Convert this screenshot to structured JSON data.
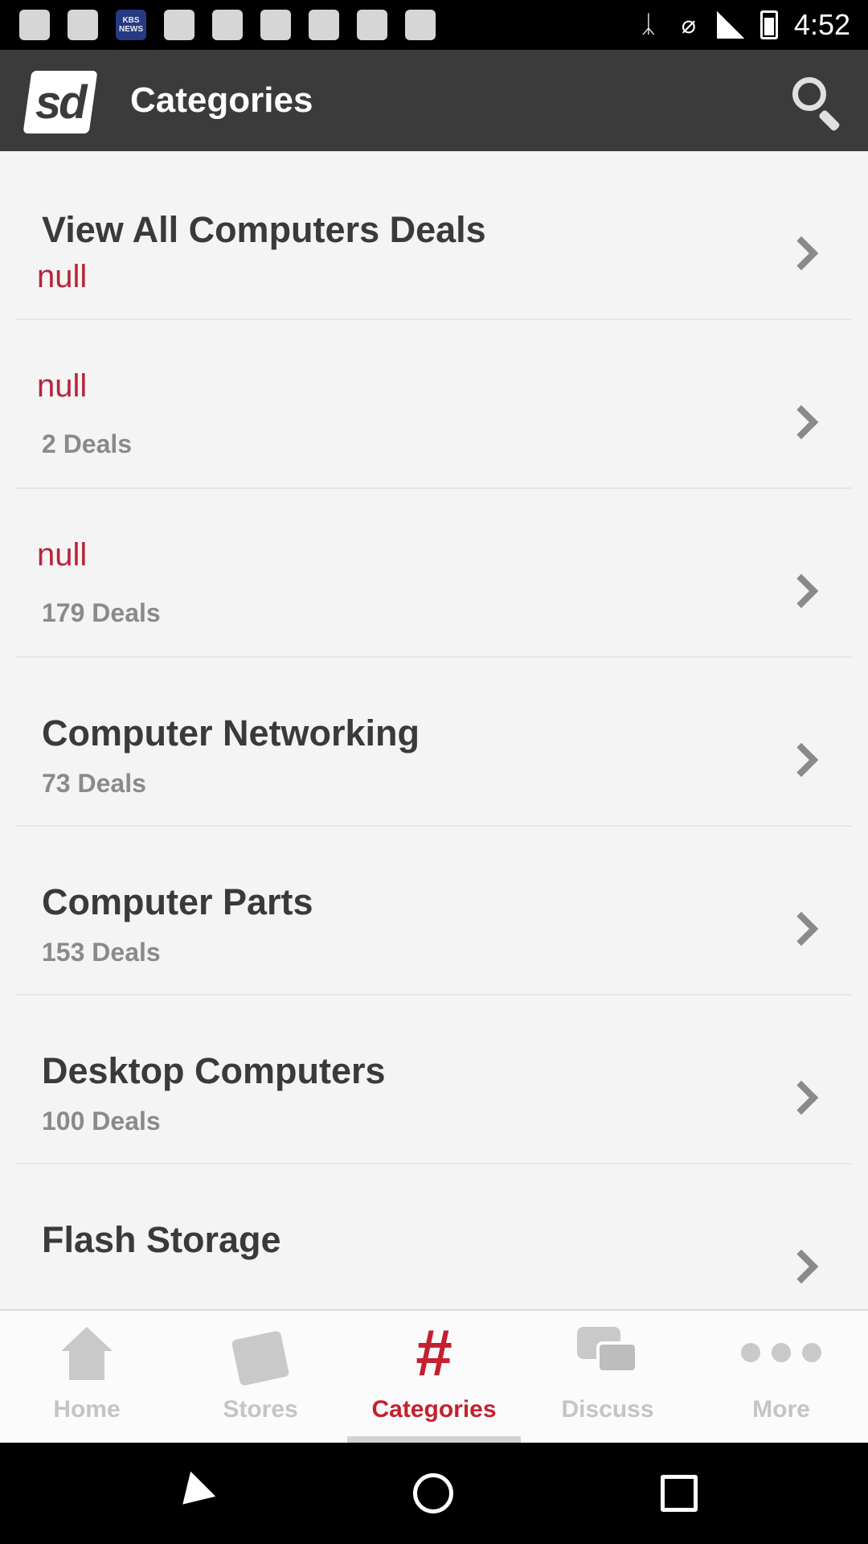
{
  "status_bar": {
    "time": "4:52",
    "left_icons": [
      "notification-icon",
      "flipboard-icon",
      "kbs-news-icon",
      "message-icon",
      "flipboard-icon",
      "proxy-icon",
      "satellite-icon",
      "lock-icon",
      "game-icon"
    ],
    "kbs_label": "KBS NEWS",
    "right_icons": [
      "bluetooth-icon",
      "mute-icon",
      "signal-icon",
      "battery-icon"
    ]
  },
  "app_bar": {
    "logo_text": "sd",
    "title": "Categories",
    "search_icon": "search-icon"
  },
  "categories": [
    {
      "title": "View All Computers Deals",
      "null_text": "null",
      "count": ""
    },
    {
      "title": "",
      "null_text": "null",
      "count": "2 Deals"
    },
    {
      "title": "",
      "null_text": "null",
      "count": "179 Deals"
    },
    {
      "title": "Computer Networking",
      "null_text": "",
      "count": "73 Deals"
    },
    {
      "title": "Computer Parts",
      "null_text": "",
      "count": "153 Deals"
    },
    {
      "title": "Desktop Computers",
      "null_text": "",
      "count": "100 Deals"
    },
    {
      "title": "Flash Storage",
      "null_text": "",
      "count": ""
    }
  ],
  "bottom_nav": {
    "tabs": [
      {
        "label": "Home",
        "icon": "home-icon"
      },
      {
        "label": "Stores",
        "icon": "tag-icon"
      },
      {
        "label": "Categories",
        "icon": "hash-icon",
        "active": true
      },
      {
        "label": "Discuss",
        "icon": "chat-icon"
      },
      {
        "label": "More",
        "icon": "more-icon"
      }
    ],
    "active_color": "#c4202f",
    "inactive_color": "#c4c4c4"
  },
  "system_nav": {
    "buttons": [
      "back-icon",
      "home-circle-icon",
      "recent-apps-icon"
    ]
  },
  "colors": {
    "app_bar": "#3b3b3b",
    "null_text": "#b8243a",
    "background": "#f4f4f4"
  }
}
